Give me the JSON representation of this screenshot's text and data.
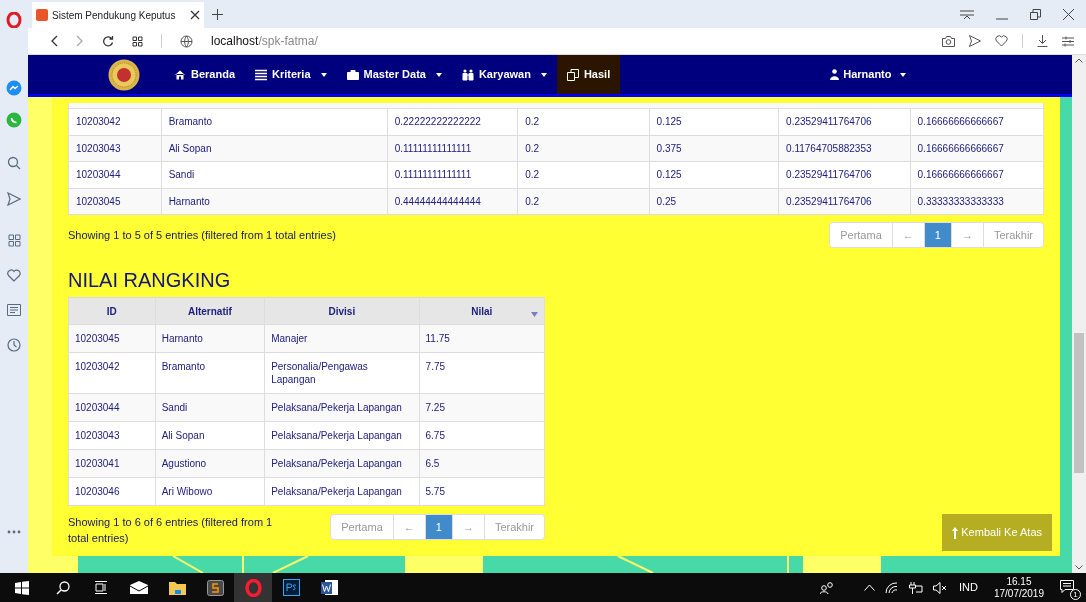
{
  "browser": {
    "tab_title": "Sistem Pendukung Keputus",
    "url_host": "localhost",
    "url_path": "/spk-fatma/"
  },
  "navbar": {
    "items": [
      {
        "label": "Beranda",
        "dropdown": false,
        "selected": false
      },
      {
        "label": "Kriteria",
        "dropdown": true,
        "selected": false
      },
      {
        "label": "Master Data",
        "dropdown": true,
        "selected": false
      },
      {
        "label": "Karyawan",
        "dropdown": true,
        "selected": false
      },
      {
        "label": "Hasil",
        "dropdown": false,
        "selected": true
      }
    ],
    "user": {
      "label": "Harnanto",
      "dropdown": true
    }
  },
  "normalized_table": {
    "rows": [
      [
        "10203042",
        "Bramanto",
        "0.22222222222222",
        "0.2",
        "0.125",
        "0.23529411764706",
        "0.16666666666667"
      ],
      [
        "10203043",
        "Ali Sopan",
        "0.11111111111111",
        "0.2",
        "0.375",
        "0.11764705882353",
        "0.16666666666667"
      ],
      [
        "10203044",
        "Sandi",
        "0.11111111111111",
        "0.2",
        "0.125",
        "0.23529411764706",
        "0.16666666666667"
      ],
      [
        "10203045",
        "Harnanto",
        "0.44444444444444",
        "0.2",
        "0.25",
        "0.23529411764706",
        "0.33333333333333"
      ]
    ],
    "info": "Showing 1 to 5 of 5 entries (filtered from 1 total entries)",
    "pagination": [
      {
        "label": "Pertama",
        "selected": false
      },
      {
        "label": "←",
        "selected": false
      },
      {
        "label": "1",
        "selected": true
      },
      {
        "label": "→",
        "selected": false
      },
      {
        "label": "Terakhir",
        "selected": false
      }
    ]
  },
  "ranking": {
    "title": "NILAI RANGKING",
    "columns": [
      "ID",
      "Alternatif",
      "Divisi",
      "Nilai"
    ],
    "rows": [
      [
        "10203045",
        "Harnanto",
        "Manajer",
        "11.75"
      ],
      [
        "10203042",
        "Bramanto",
        "Personalia/Pengawas Lapangan",
        "7.75"
      ],
      [
        "10203044",
        "Sandi",
        "Pelaksana/Pekerja Lapangan",
        "7.25"
      ],
      [
        "10203043",
        "Ali Sopan",
        "Pelaksana/Pekerja Lapangan",
        "6.75"
      ],
      [
        "10203041",
        "Agustiono",
        "Pelaksana/Pekerja Lapangan",
        "6.5"
      ],
      [
        "10203046",
        "Ari Wibowo",
        "Pelaksana/Pekerja Lapangan",
        "5.75"
      ]
    ],
    "info": "Showing 1 to 6 of 6 entries (filtered from 1 total entries)",
    "pagination": [
      {
        "label": "Pertama",
        "selected": false
      },
      {
        "label": "←",
        "selected": false
      },
      {
        "label": "1",
        "selected": true
      },
      {
        "label": "→",
        "selected": false
      },
      {
        "label": "Terakhir",
        "selected": false
      }
    ]
  },
  "back_to_top": {
    "label": "Kembali Ke Atas"
  },
  "taskbar": {
    "language": "IND",
    "time": "16.15",
    "date": "17/07/2019",
    "notifications": "1"
  }
}
